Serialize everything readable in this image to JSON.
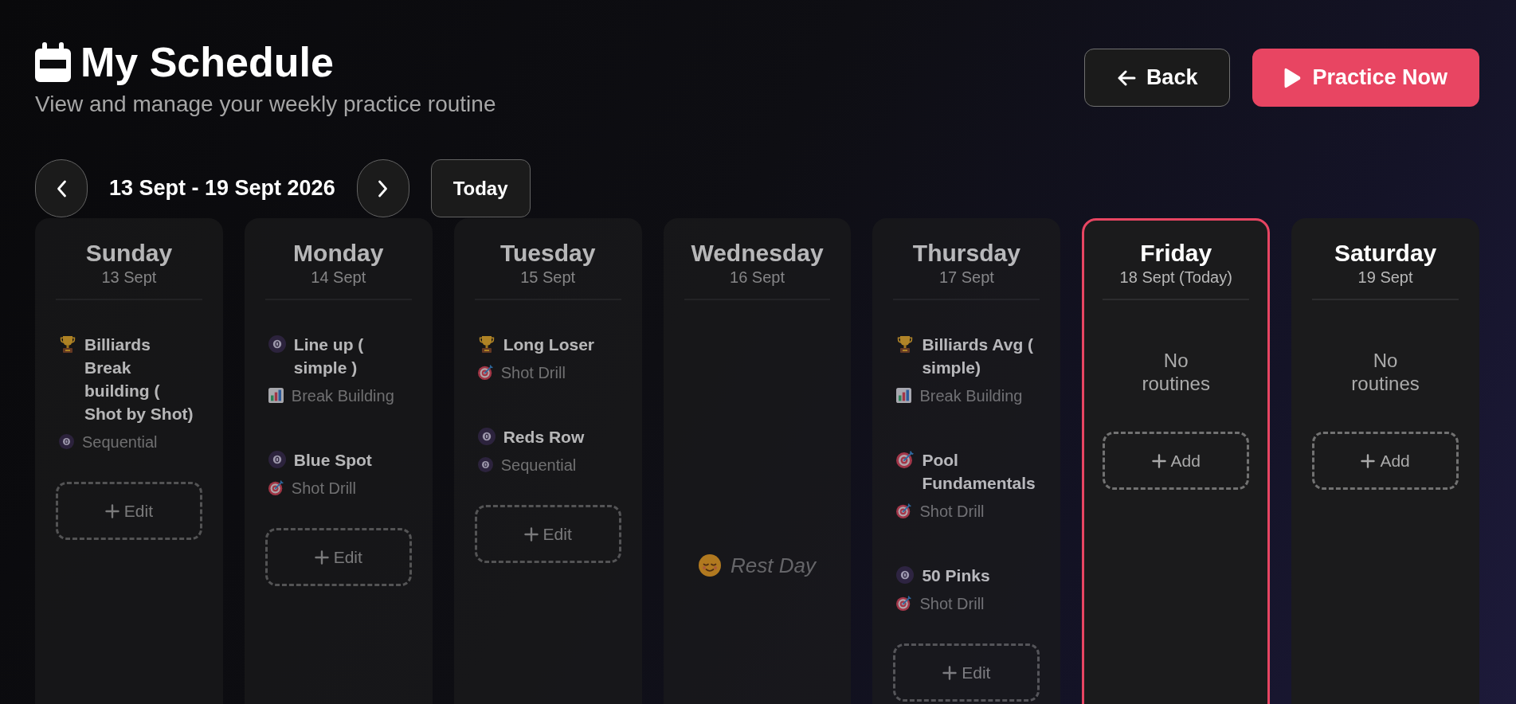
{
  "header": {
    "title": "My Schedule",
    "subtitle": "View and manage your weekly practice routine"
  },
  "actions": [
    {
      "kind": "back",
      "label": "Back"
    },
    {
      "kind": "primary",
      "label": "Practice Now"
    }
  ],
  "week_nav": {
    "range": "13 Sept - 19 Sept 2026",
    "today_button": "Today"
  },
  "days": [
    {
      "name": "Sunday",
      "date": "13 Sept",
      "past": true,
      "today": false,
      "kind": "routines",
      "routines": [
        {
          "kind": "trophy",
          "title": "Billiards Break building ( Shot by Shot)",
          "type": {
            "kind": "ball",
            "label": "Sequential"
          }
        }
      ],
      "button": "Edit"
    },
    {
      "name": "Monday",
      "date": "14 Sept",
      "past": true,
      "today": false,
      "kind": "routines",
      "routines": [
        {
          "kind": "ball",
          "title": "Line up ( simple )",
          "type": {
            "kind": "chart",
            "label": "Break Building"
          }
        },
        {
          "kind": "ball",
          "title": "Blue Spot",
          "type": {
            "kind": "target",
            "label": "Shot Drill"
          }
        }
      ],
      "button": "Edit"
    },
    {
      "name": "Tuesday",
      "date": "15 Sept",
      "past": true,
      "today": false,
      "kind": "routines",
      "routines": [
        {
          "kind": "trophy",
          "title": "Long Loser",
          "type": {
            "kind": "target",
            "label": "Shot Drill"
          }
        },
        {
          "kind": "ball",
          "title": "Reds Row",
          "type": {
            "kind": "ball",
            "label": "Sequential"
          }
        }
      ],
      "button": "Edit"
    },
    {
      "name": "Wednesday",
      "date": "16 Sept",
      "past": true,
      "today": false,
      "kind": "rest",
      "note": "Rest Day"
    },
    {
      "name": "Thursday",
      "date": "17 Sept",
      "past": true,
      "today": false,
      "kind": "routines",
      "routines": [
        {
          "kind": "trophy",
          "title": "Billiards Avg ( simple)",
          "type": {
            "kind": "chart",
            "label": "Break Building"
          }
        },
        {
          "kind": "target",
          "title": "Pool Fundamentals",
          "type": {
            "kind": "target",
            "label": "Shot Drill"
          }
        },
        {
          "kind": "ball",
          "title": "50 Pinks",
          "type": {
            "kind": "target",
            "label": "Shot Drill"
          }
        }
      ],
      "button": "Edit"
    },
    {
      "name": "Friday",
      "date": "18 Sept (Today)",
      "past": false,
      "today": true,
      "kind": "empty",
      "note": "No routines",
      "button": "Add"
    },
    {
      "name": "Saturday",
      "date": "19 Sept",
      "past": false,
      "today": false,
      "kind": "empty",
      "note": "No routines",
      "button": "Add"
    }
  ]
}
